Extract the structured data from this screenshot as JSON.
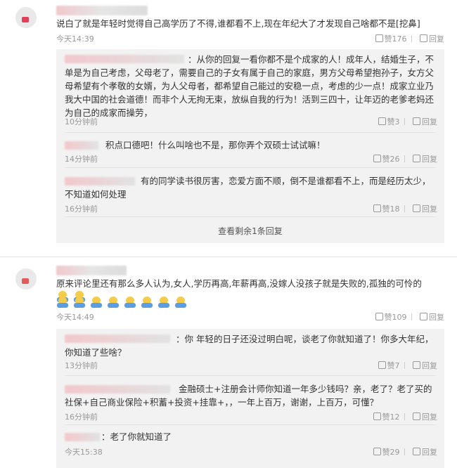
{
  "comments": [
    {
      "text": "说白了就是年轻时觉得自己高学历了不得,谁都看不上,现在年纪大了才发现自己啥都不是[挖鼻]",
      "time": "今天14:39",
      "like_label": "赞176",
      "reply_label": "回复",
      "replies": [
        {
          "text": "：从你的回复一看你都不是个成家的人！成年人，结婚生子，不单是为自己考虑，父母老了，需要自己的子女有属于自己的家庭，男方父母希望抱孙子，女方父母希望有个孝敬的女婿，为人父母者，都希望自己能过的安稳一点，考虑的少一点！成家立业乃我大中国的社会道德！而非个人无拘无束，放纵自我的行为！活到三四十，让年迈的老爹老妈还为自己的成家而操劳，",
          "time": "10分钟前",
          "like_label": "赞3",
          "reply_label": "回复"
        },
        {
          "text": "积点口德吧！什么叫啥也不是，那你弄个双硕士试试嘛！",
          "time": "14分钟前",
          "like_label": "赞26",
          "reply_label": "回复"
        },
        {
          "text": "有的同学读书很厉害，恋爱方面不顺，倒不是谁都看不上，而是经历太少，不知道如何处理",
          "time": "16分钟前",
          "like_label": "赞18",
          "reply_label": "回复"
        }
      ],
      "more_label": "查看剩余1条回复"
    },
    {
      "text": "原来评论里还有那么多人认为,女人,学历再高,年薪再高,没嫁人没孩子就是失败的,孤独的可怜的",
      "time": "今天14:49",
      "like_label": "赞109",
      "reply_label": "回复",
      "replies": [
        {
          "text": "：你  年轻的日子还没过明白呢，谈老了你就知道了！你多大年纪，你知道了些啥？",
          "time": "13分钟前",
          "like_label": "赞7",
          "reply_label": "回复"
        },
        {
          "text": "金融硕士+注册会计师你知道一年多少钱吗？亲，老了？老了买的社保+自己商业保险+积蓄+投资+挂靠+，，一年上百万，谢谢，上百万，可懂？",
          "time": "16分钟前",
          "like_label": "赞12",
          "reply_label": "回复"
        },
        {
          "text": "：老了你就知道了",
          "time": "今天15:38",
          "like_label": "赞29",
          "reply_label": "回复"
        }
      ]
    }
  ],
  "icons": {
    "like": "thumbs-up-icon",
    "reply": "reply-icon",
    "emoji": "wrapped-baby-emoji"
  },
  "colors": {
    "reply_bg": "#f2f2f2",
    "meta_text": "#999999",
    "accent_avatar": "#e0405a",
    "emoji_head": "#f5cc4a",
    "emoji_body": "#5a9de0"
  }
}
